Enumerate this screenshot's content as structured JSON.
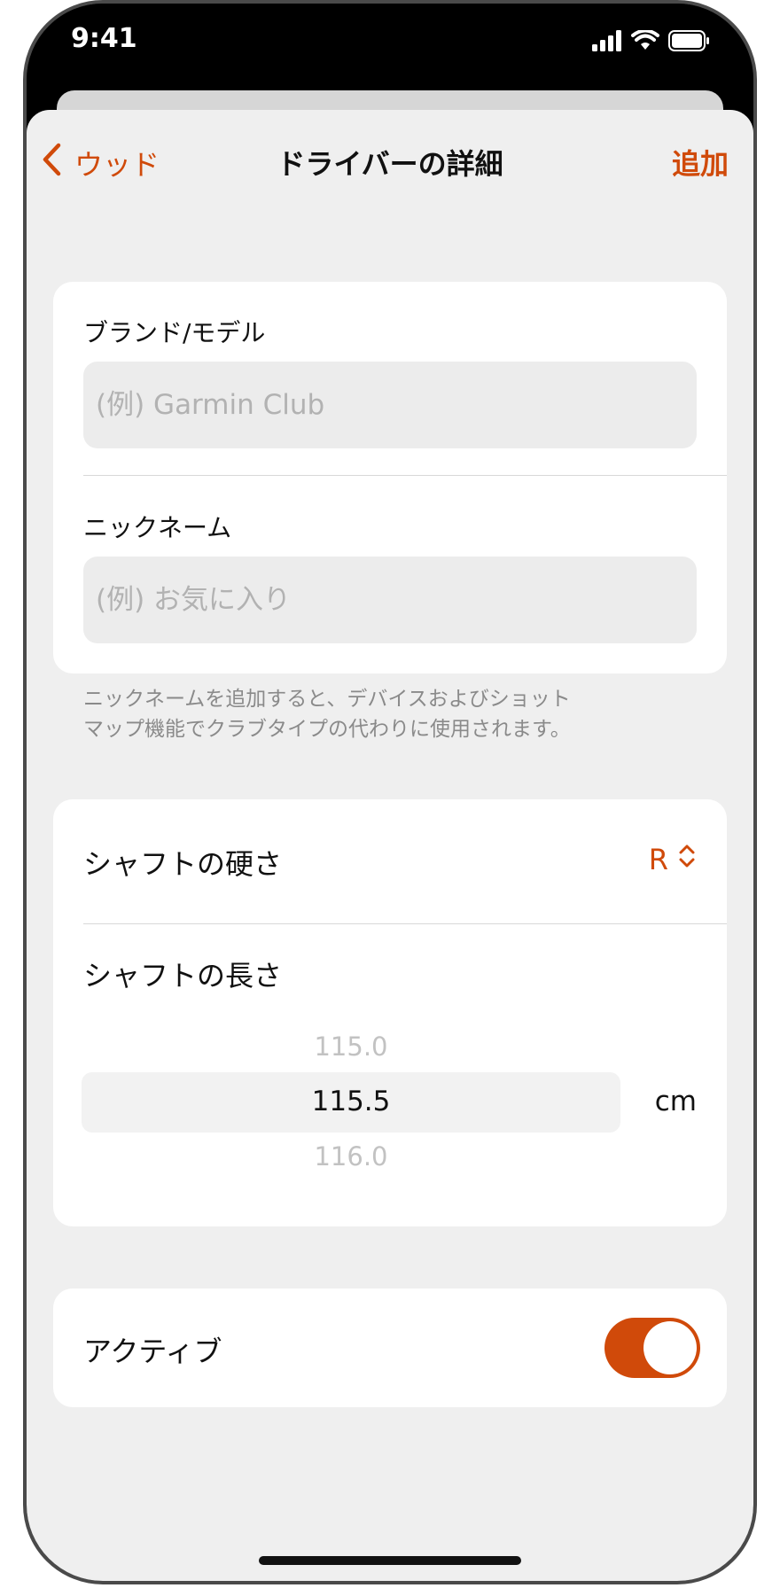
{
  "status": {
    "time": "9:41"
  },
  "nav": {
    "back_label": "ウッド",
    "title": "ドライバーの詳細",
    "add_label": "追加"
  },
  "brand": {
    "label": "ブランド/モデル",
    "placeholder": "(例) Garmin Club"
  },
  "nickname": {
    "label": "ニックネーム",
    "placeholder": "(例) お気に入り",
    "helper_line1": "ニックネームを追加すると、デバイスおよびショット",
    "helper_line2": "マップ機能でクラブタイプの代わりに使用されます。"
  },
  "shaft": {
    "stiffness_label": "シャフトの硬さ",
    "stiffness_value": "R",
    "length_label": "シャフトの長さ",
    "picker": {
      "prev": "115.0",
      "selected": "115.5",
      "next": "116.0"
    },
    "unit": "cm"
  },
  "active": {
    "label": "アクティブ",
    "on": true
  },
  "colors": {
    "accent": "#d04a0a",
    "sheet_bg": "#efefef",
    "card_bg": "#ffffff"
  },
  "icons": [
    "signal-icon",
    "wifi-icon",
    "battery-icon",
    "chevron-left-icon",
    "chevron-updown-icon"
  ]
}
